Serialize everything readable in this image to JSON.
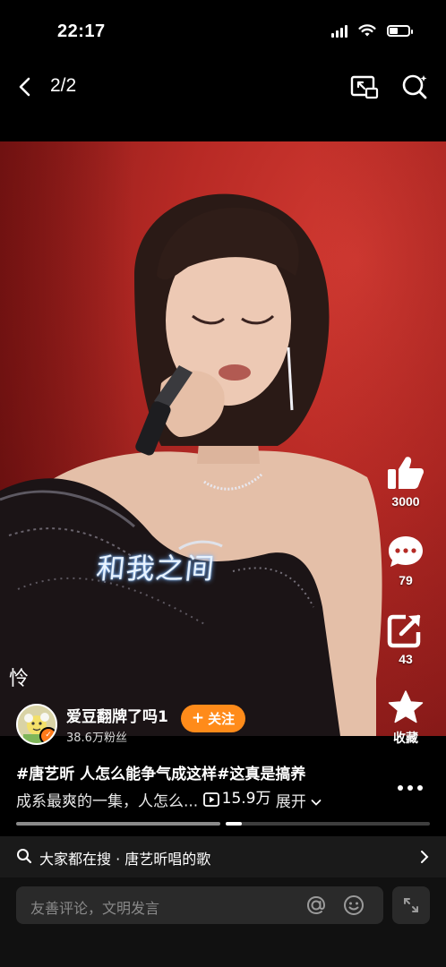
{
  "status_bar": {
    "time": "22:17"
  },
  "nav": {
    "page_indicator": "2/2"
  },
  "video": {
    "lyric_main": "和我之间",
    "lyric_side": "怜"
  },
  "actions": {
    "like_count": "3000",
    "comment_count": "79",
    "share_count": "43",
    "favorite_label": "收藏"
  },
  "author": {
    "name": "爱豆翻牌了吗1",
    "fans": "38.6万粉丝",
    "follow_label": "关注"
  },
  "description": {
    "line1": "#唐艺昕 人怎么能争气成这样#这真是搞养",
    "line2": "成系最爽的一集，人怎么...",
    "views": "15.9万",
    "expand_label": "展开"
  },
  "progress": {
    "segments": 2,
    "active_segment": 2
  },
  "search_suggestion": {
    "prefix": "大家都在搜",
    "separator": "·",
    "query": "唐艺昕唱的歌"
  },
  "comment": {
    "placeholder": "友善评论，文明发言"
  },
  "colors": {
    "follow_button": "#ff8b1a",
    "background": "#000000",
    "video_red": "#c8332c"
  }
}
